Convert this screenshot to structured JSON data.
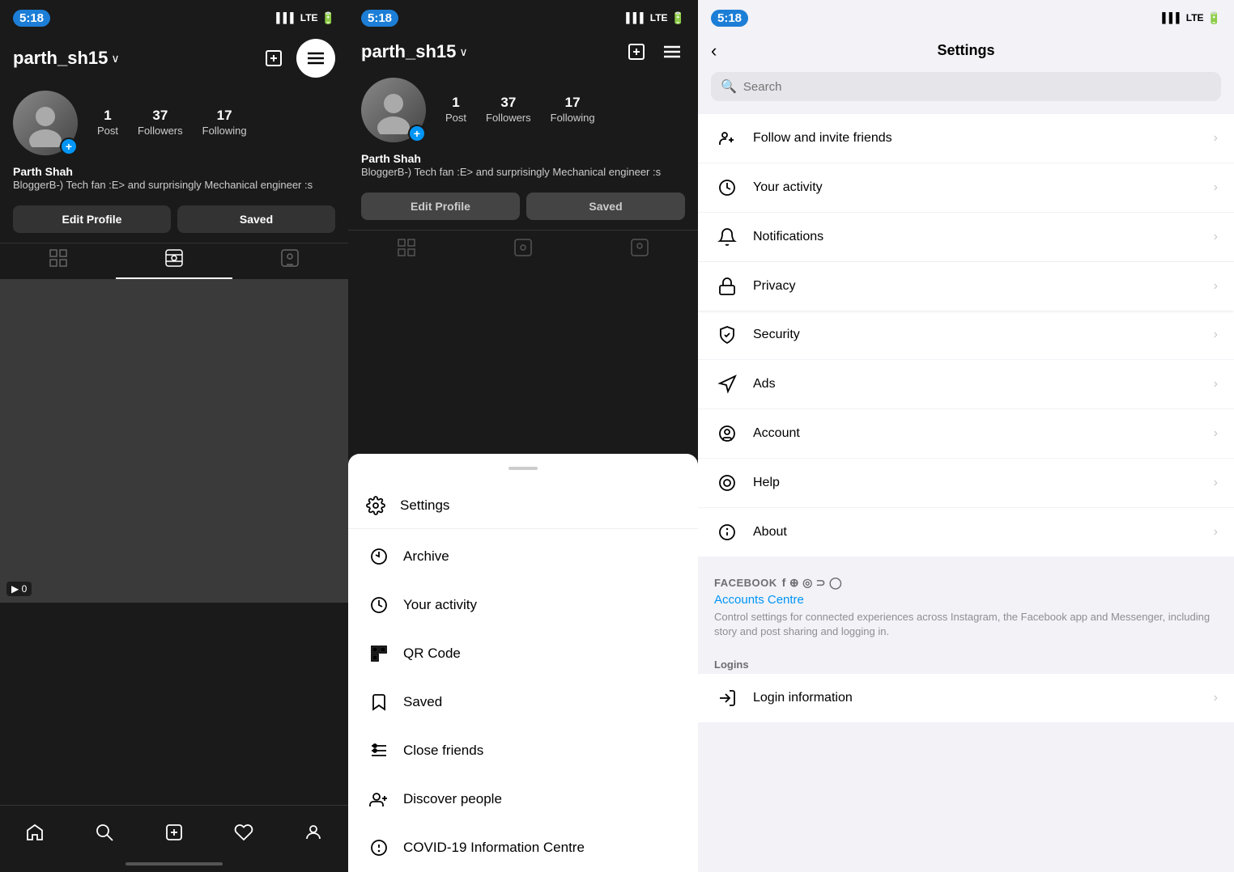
{
  "panel1": {
    "status_time": "5:18",
    "lte": "LTE",
    "username": "parth_sh15",
    "stats": [
      {
        "num": "1",
        "label": "Post"
      },
      {
        "num": "37",
        "label": "Followers"
      },
      {
        "num": "17",
        "label": "Following"
      }
    ],
    "bio_name": "Parth Shah",
    "bio_text": "BloggerB-) Tech fan :E> and surprisingly Mechanical engineer :s",
    "edit_profile_label": "Edit Profile",
    "saved_label": "Saved",
    "nav": [
      "🏠",
      "🔍",
      "➕",
      "♡",
      "👤"
    ]
  },
  "panel2": {
    "status_time": "5:18",
    "lte": "LTE",
    "username": "parth_sh15",
    "stats": [
      {
        "num": "1",
        "label": "Post"
      },
      {
        "num": "37",
        "label": "Followers"
      },
      {
        "num": "17",
        "label": "Following"
      }
    ],
    "bio_name": "Parth Shah",
    "bio_text": "BloggerB-) Tech fan :E> and surprisingly Mechanical engineer :s",
    "edit_profile_label": "Edit Profile",
    "saved_label": "Saved",
    "menu_items": [
      {
        "icon": "⚙",
        "label": "Settings",
        "is_settings": true
      },
      {
        "icon": "🕐",
        "label": "Archive"
      },
      {
        "icon": "🕐",
        "label": "Your activity"
      },
      {
        "icon": "⊞",
        "label": "QR Code"
      },
      {
        "icon": "🔖",
        "label": "Saved"
      },
      {
        "icon": "☰",
        "label": "Close friends"
      },
      {
        "icon": "👤+",
        "label": "Discover people"
      },
      {
        "icon": "⊕",
        "label": "COVID-19 Information Centre"
      }
    ]
  },
  "panel3": {
    "status_time": "5:18",
    "lte": "LTE",
    "title": "Settings",
    "search_placeholder": "Search",
    "settings_items": [
      {
        "icon": "follow",
        "label": "Follow and invite friends"
      },
      {
        "icon": "activity",
        "label": "Your activity"
      },
      {
        "icon": "bell",
        "label": "Notifications"
      },
      {
        "icon": "lock",
        "label": "Privacy",
        "highlighted": true
      },
      {
        "icon": "shield",
        "label": "Security"
      },
      {
        "icon": "megaphone",
        "label": "Ads"
      },
      {
        "icon": "account",
        "label": "Account"
      },
      {
        "icon": "help",
        "label": "Help"
      },
      {
        "icon": "info",
        "label": "About"
      }
    ],
    "facebook_title": "FACEBOOK",
    "accounts_centre_label": "Accounts Centre",
    "fb_description": "Control settings for connected experiences across Instagram, the Facebook app and Messenger, including story and post sharing and logging in.",
    "logins_title": "Logins",
    "login_info_label": "Login information"
  }
}
